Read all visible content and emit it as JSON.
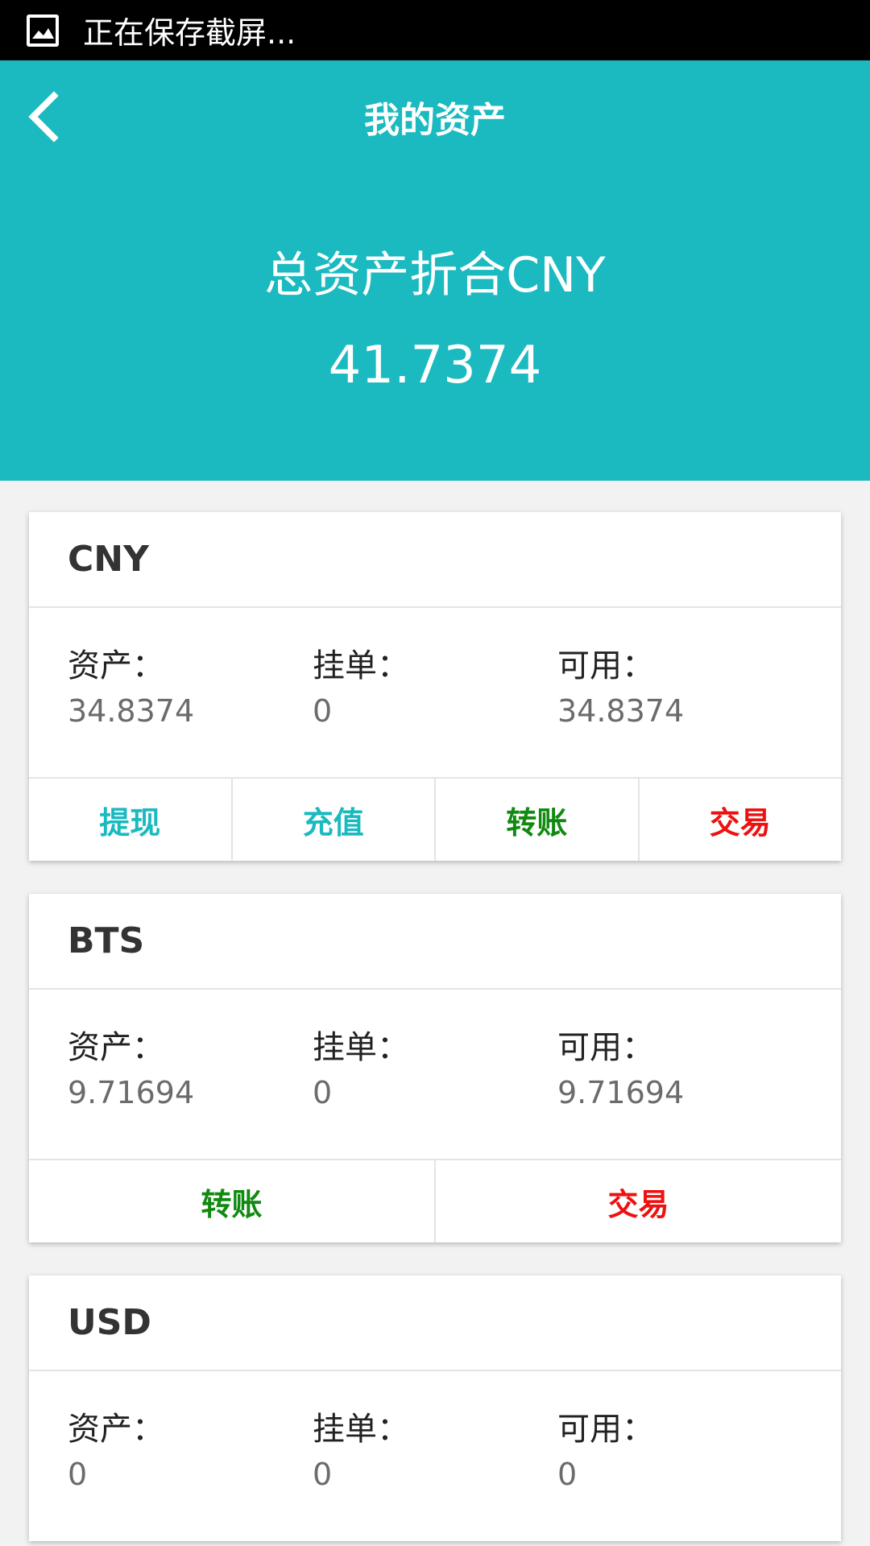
{
  "status_bar": {
    "text": "正在保存截屏..."
  },
  "header": {
    "title": "我的资产",
    "total_label": "总资产折合CNY",
    "total_value": "41.7374"
  },
  "colors": {
    "accent": "#1bbac0",
    "transfer": "#118a11",
    "trade": "#ee1111"
  },
  "cards": [
    {
      "currency": "CNY",
      "asset_label": "资产：",
      "asset_value": "34.8374",
      "order_label": "挂单：",
      "order_value": "0",
      "available_label": "可用：",
      "available_value": "34.8374",
      "actions": [
        {
          "label": "提现"
        },
        {
          "label": "充值"
        },
        {
          "label": "转账"
        },
        {
          "label": "交易"
        }
      ]
    },
    {
      "currency": "BTS",
      "asset_label": "资产：",
      "asset_value": "9.71694",
      "order_label": "挂单：",
      "order_value": "0",
      "available_label": "可用：",
      "available_value": "9.71694",
      "actions": [
        {
          "label": "转账"
        },
        {
          "label": "交易"
        }
      ]
    },
    {
      "currency": "USD",
      "asset_label": "资产：",
      "asset_value": "0",
      "order_label": "挂单：",
      "order_value": "0",
      "available_label": "可用：",
      "available_value": "0"
    }
  ]
}
